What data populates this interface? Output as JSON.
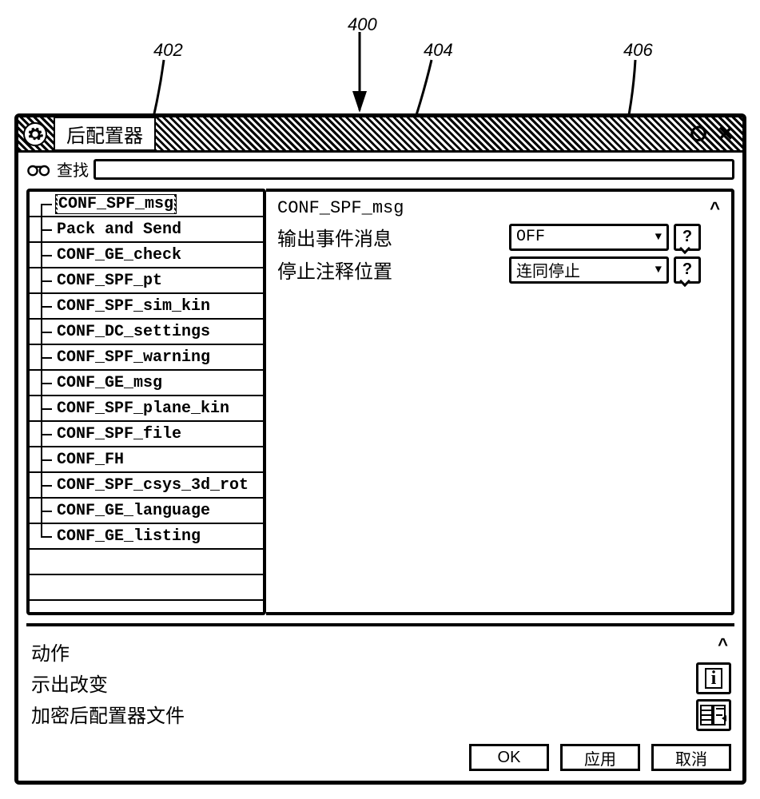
{
  "callouts": {
    "c400": "400",
    "c402": "402",
    "c404": "404",
    "c406": "406"
  },
  "window": {
    "title": "后配置器",
    "min_label": "⭘",
    "close_label": "✕"
  },
  "search": {
    "label": "查找",
    "value": ""
  },
  "tree": {
    "items": [
      "CONF_SPF_msg",
      "Pack and Send",
      "CONF_GE_check",
      "CONF_SPF_pt",
      "CONF_SPF_sim_kin",
      "CONF_DC_settings",
      "CONF_SPF_warning",
      "CONF_GE_msg",
      "CONF_SPF_plane_kin",
      "CONF_SPF_file",
      "CONF_FH",
      "CONF_SPF_csys_3d_rot",
      "CONF_GE_language",
      "CONF_GE_listing"
    ],
    "selected_index": 0
  },
  "detail": {
    "heading": "CONF_SPF_msg",
    "rows": [
      {
        "label": "输出事件消息",
        "value": "OFF"
      },
      {
        "label": "停止注释位置",
        "value": "连同停止"
      }
    ],
    "help_label": "?",
    "collapse_label": "^"
  },
  "actions": {
    "lines": [
      "动作",
      "示出改变",
      "加密后配置器文件"
    ],
    "info_label": "i",
    "collapse_label": "^"
  },
  "buttons": {
    "ok": "OK",
    "apply": "应用",
    "cancel": "取消"
  }
}
